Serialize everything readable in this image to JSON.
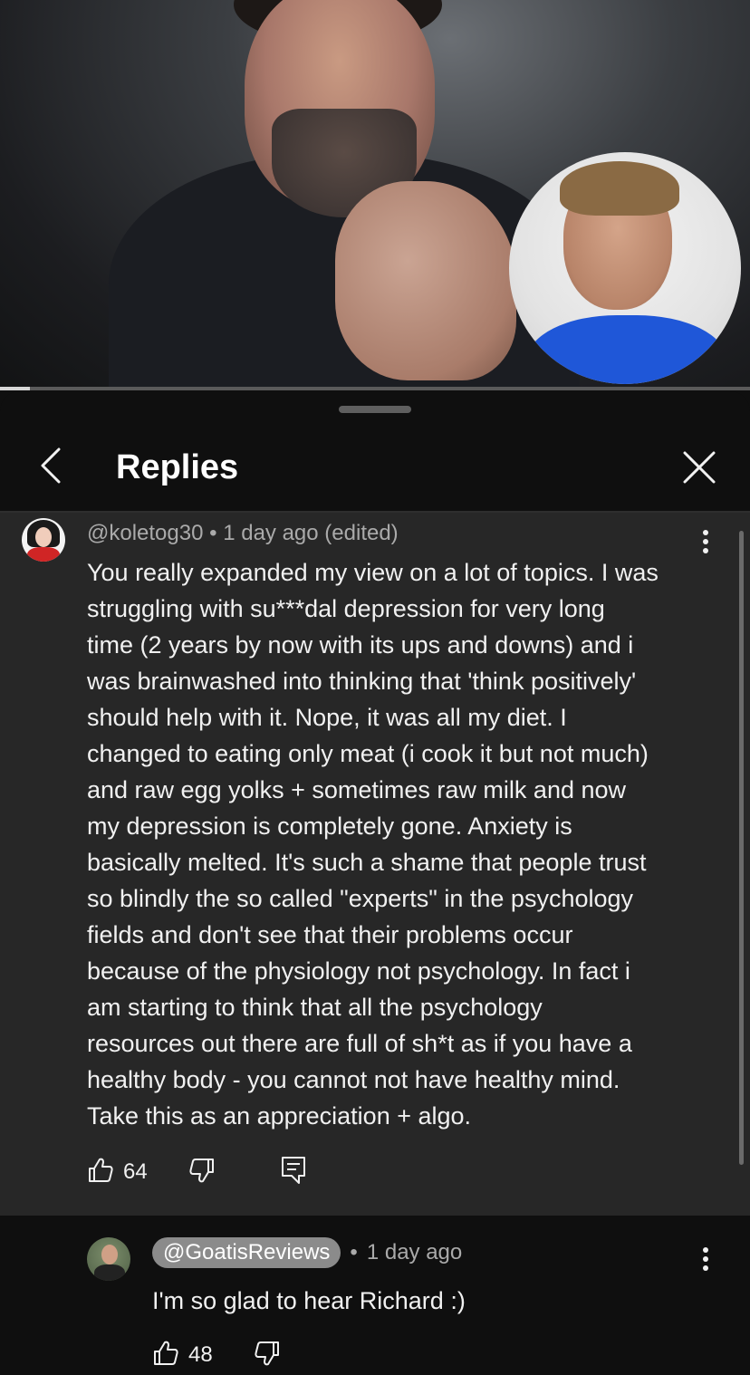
{
  "video": {
    "progress_fraction": 0.04
  },
  "header": {
    "title": "Replies"
  },
  "comment": {
    "author": "@koletog30",
    "separator": "•",
    "time": "1 day ago (edited)",
    "text": "You really expanded my view on a lot of topics. I was\nstruggling with su***dal depression for very long\ntime (2 years by now with its ups and downs) and i\nwas brainwashed into thinking that 'think positively'\nshould help with it. Nope, it was all my diet. I\nchanged to eating only meat (i cook it but not much)\nand raw egg yolks + sometimes raw milk and now\nmy depression is completely gone. Anxiety is\nbasically melted. It's such a shame that people trust\nso blindly the so called \"experts\" in the psychology\nfields and don't see that their problems occur\nbecause of the physiology not psychology. In fact i\nam starting to think that all the psychology\nresources out there are full of sh*t as if you have a\nhealthy body - you cannot not have healthy mind.\nTake this as an appreciation + algo.",
    "likes": "64"
  },
  "reply": {
    "author": "@GoatisReviews",
    "separator": "•",
    "time": "1 day ago",
    "text": "I'm so glad to hear Richard :)",
    "likes": "48"
  },
  "icons": {
    "back": "chevron-left-icon",
    "close": "close-icon",
    "more": "more-vertical-icon",
    "like": "thumbs-up-icon",
    "dislike": "thumbs-down-icon",
    "reply": "reply-comment-icon"
  }
}
